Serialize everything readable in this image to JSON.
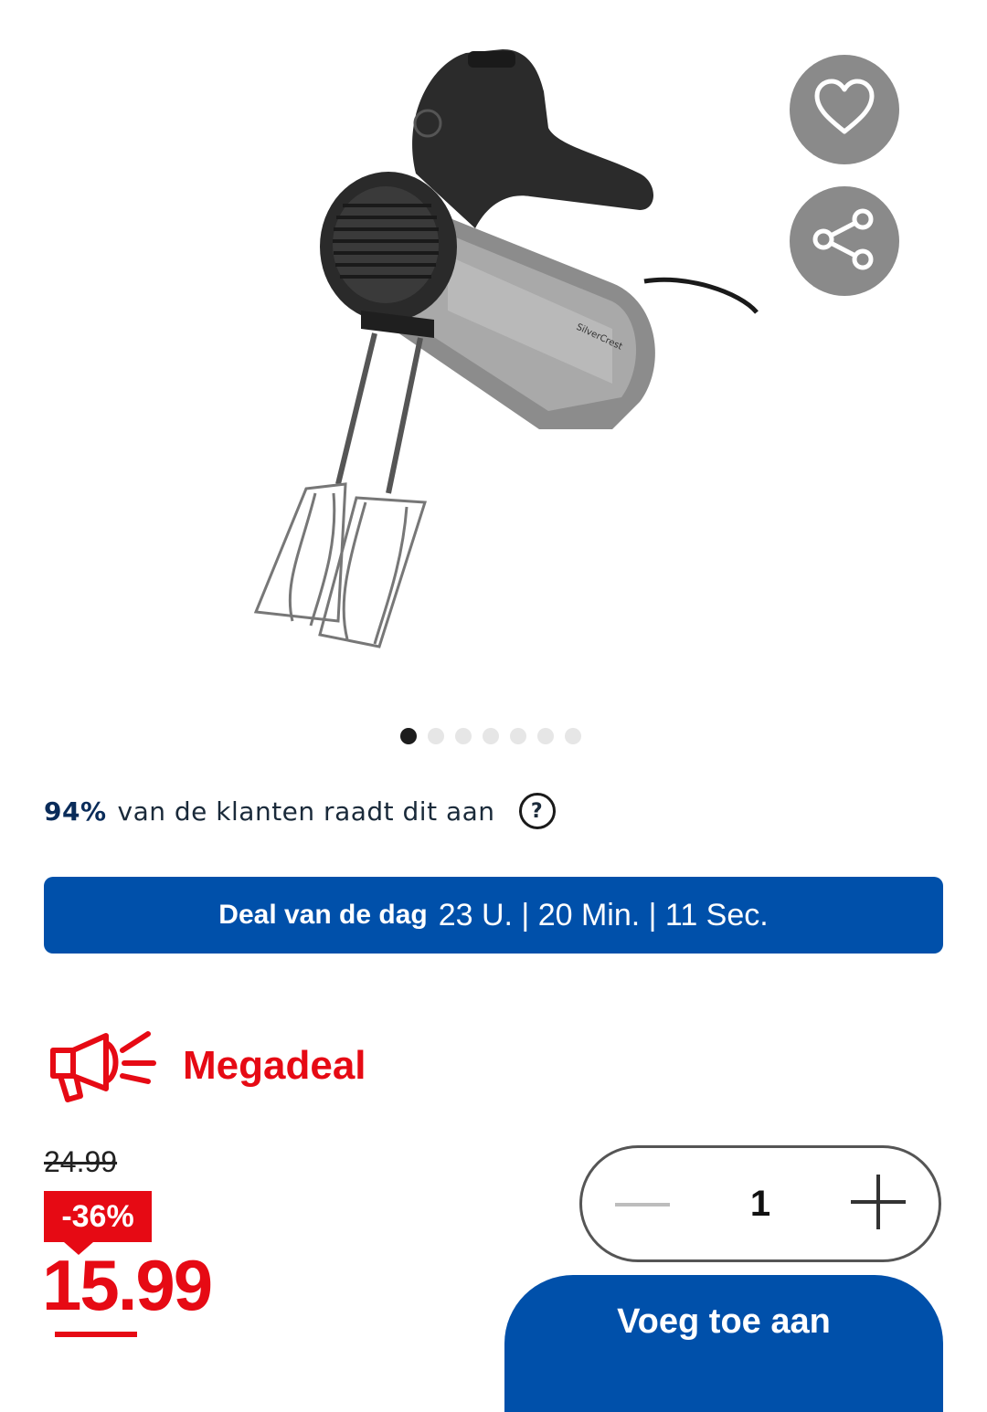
{
  "product": {
    "image_alt": "Handmixer",
    "brand_on_device": "SilverCrest"
  },
  "actions": {
    "favorite_icon": "heart-icon",
    "share_icon": "share-icon"
  },
  "carousel": {
    "total": 7,
    "active_index": 0
  },
  "recommendation": {
    "percent": "94%",
    "text": "van de klanten raadt dit aan",
    "help_symbol": "?"
  },
  "deal_banner": {
    "label": "Deal van de dag",
    "countdown": "23 U. | 20 Min. | 11 Sec."
  },
  "promo": {
    "icon": "megaphone-icon",
    "label": "Megadeal"
  },
  "pricing": {
    "old_price": "24.99",
    "discount": "-36%",
    "price": "15.99"
  },
  "quantity": {
    "value": "1"
  },
  "cart": {
    "add_label": "Voeg toe aan"
  },
  "colors": {
    "brand_blue": "#0050aa",
    "sale_red": "#e60a14",
    "button_grey": "#8a8a8a"
  }
}
